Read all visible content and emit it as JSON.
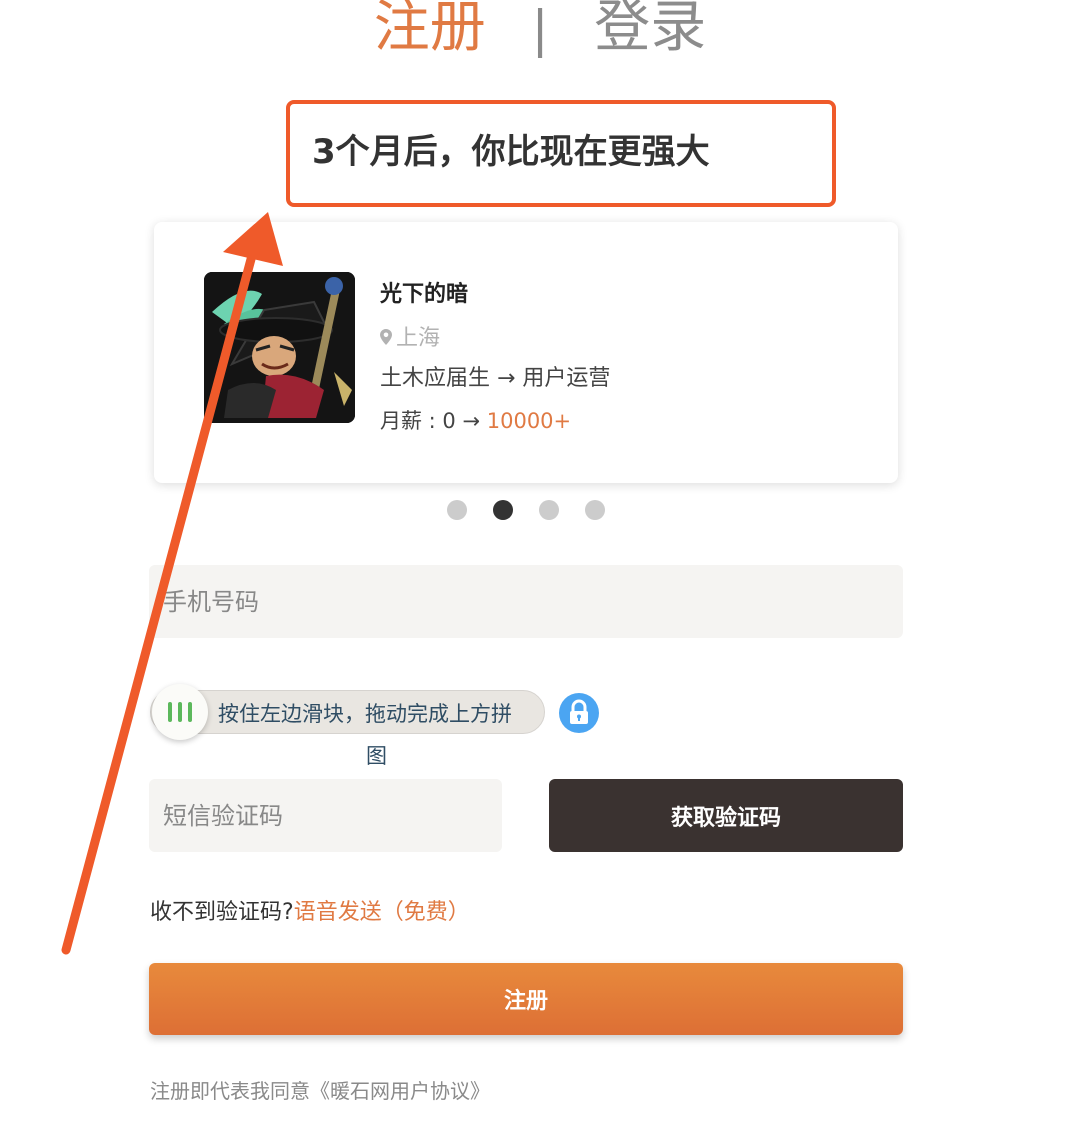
{
  "tabs": {
    "register": "注册",
    "separator": "|",
    "login": "登录"
  },
  "headline": "3个月后，你比现在更强大",
  "testimonial": {
    "name": "光下的暗",
    "city": "上海",
    "path": "土木应届生 → 用户运营",
    "salary_prefix": "月薪 : 0 → ",
    "salary_to": "10000+"
  },
  "carousel": {
    "count": 4,
    "active_index": 1
  },
  "form": {
    "phone_placeholder": "手机号码",
    "slider_hint": "按住左边滑块，拖动完成上方拼",
    "slider_hint_wrap": "图",
    "sms_placeholder": "短信验证码",
    "get_code_label": "获取验证码",
    "no_code_text": "收不到验证码?",
    "voice_send_label": "语音发送（免费）",
    "register_label": "注册",
    "agreement_text": "注册即代表我同意《暖石网用户协议》"
  },
  "colors": {
    "accent": "#e07a43",
    "annotation": "#ef5a2a",
    "dark_button": "#3a3230",
    "lock": "#4ba5f2",
    "slider_grip": "#5cb85c"
  },
  "icons": [
    "location-pin-icon",
    "lock-icon",
    "slider-grip-icon"
  ]
}
